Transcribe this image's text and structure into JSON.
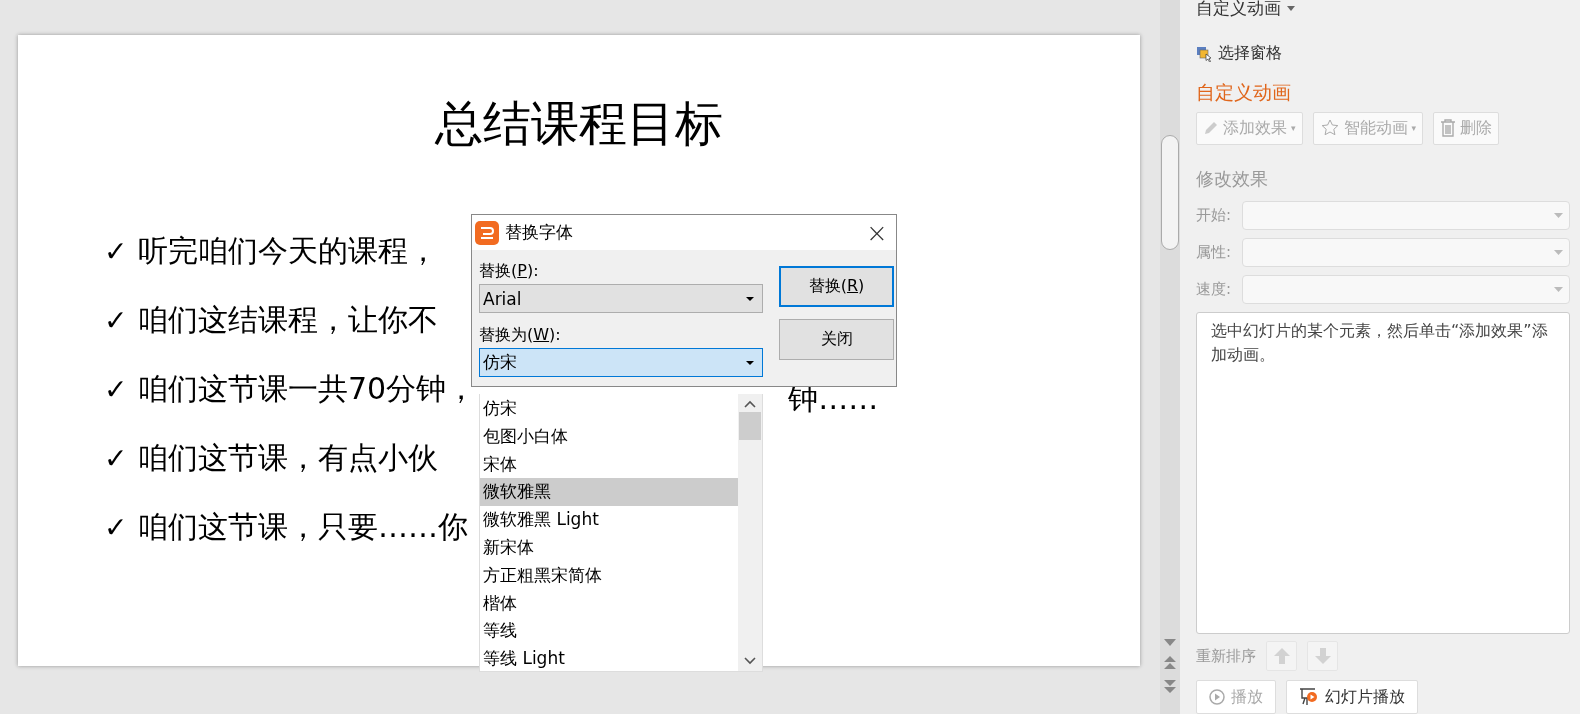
{
  "slide": {
    "title": "总结课程目标",
    "bullets": [
      {
        "mark": "✓",
        "text": "听完咱们今天的课程，"
      },
      {
        "mark": "✓",
        "text": "咱们这结课程，让你不"
      },
      {
        "mark": "✓",
        "text": "咱们这节课一共70分钟，",
        "continuation": "钟……"
      },
      {
        "mark": "✓",
        "text": "咱们这节课，有点小伙"
      },
      {
        "mark": "✓",
        "text": "咱们这节课，只要……你"
      }
    ]
  },
  "dialog": {
    "title": "替换字体",
    "close": "×",
    "replace": {
      "label": {
        "prefix": "替换(",
        "accel": "P",
        "suffix": "):"
      },
      "value": "Arial",
      "focused": false
    },
    "replace_with": {
      "label": {
        "prefix": "替换为(",
        "accel": "W",
        "suffix": "):"
      },
      "value": "仿宋",
      "focused": true
    },
    "buttons": [
      {
        "prefix": "替换(",
        "accel": "R",
        "suffix": ")",
        "default": true
      },
      {
        "prefix": "关闭",
        "default": false
      }
    ],
    "font_list": [
      {
        "label": "仿宋",
        "selected": false
      },
      {
        "label": "包图小白体",
        "selected": false
      },
      {
        "label": "宋体",
        "selected": false
      },
      {
        "label": "微软雅黑",
        "selected": true
      },
      {
        "label": "微软雅黑 Light",
        "selected": false
      },
      {
        "label": "新宋体",
        "selected": false
      },
      {
        "label": "方正粗黑宋简体",
        "selected": false
      },
      {
        "label": "楷体",
        "selected": false
      },
      {
        "label": "等线",
        "selected": false
      },
      {
        "label": "等线 Light",
        "selected": false
      }
    ]
  },
  "task_pane": {
    "header": "自定义动画",
    "selection_pane": "选择窗格",
    "section_title": "自定义动画",
    "actions": [
      {
        "kind": "pencil",
        "label": "添加效果",
        "caret": "▾",
        "disabled": true
      },
      {
        "kind": "star",
        "label": "智能动画",
        "caret": "▾",
        "disabled": true
      },
      {
        "kind": "trash",
        "label": "删除",
        "disabled": true
      }
    ],
    "modify_title": "修改效果",
    "fields": [
      {
        "label": "开始:",
        "disabled": true
      },
      {
        "label": "属性:",
        "disabled": true
      },
      {
        "label": "速度:",
        "disabled": true
      }
    ],
    "hint": "选中幻灯片的某个元素，然后单击“添加效果”添加动画。",
    "reorder": {
      "label": "重新排序",
      "up_disabled": true,
      "down_disabled": true
    },
    "bottom_buttons": [
      {
        "kind": "play",
        "label": "播放",
        "disabled": true
      },
      {
        "kind": "slideshow",
        "label": "幻灯片播放",
        "disabled": false
      }
    ]
  }
}
